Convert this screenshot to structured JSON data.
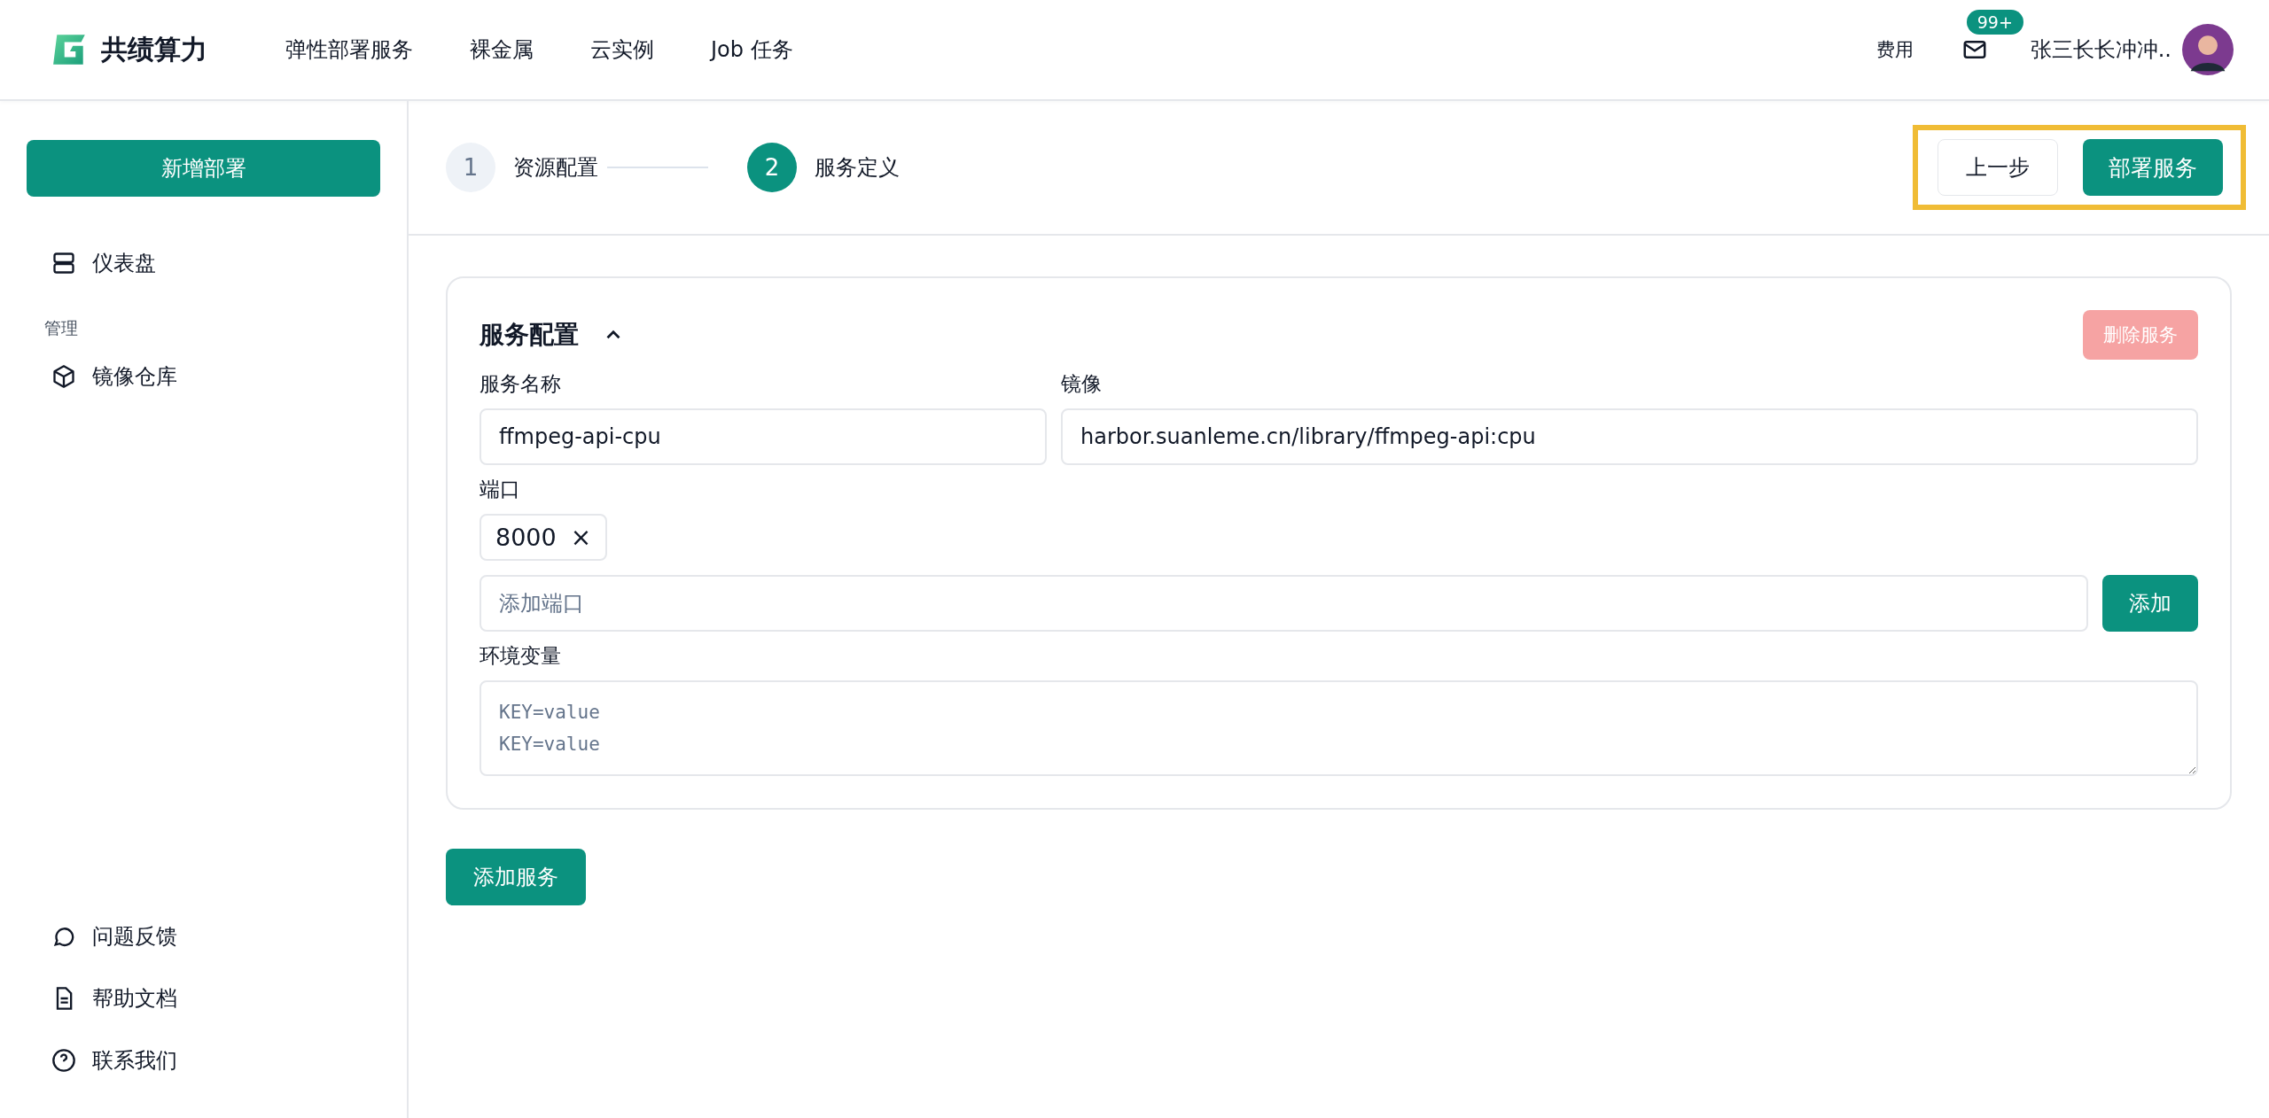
{
  "header": {
    "brand": "共绩算力",
    "nav": [
      {
        "label": "弹性部署服务",
        "selected": false
      },
      {
        "label": "裸金属",
        "selected": false
      },
      {
        "label": "云实例",
        "selected": false
      },
      {
        "label": "Job 任务",
        "selected": false
      }
    ],
    "billing": "费用",
    "mail_badge": "99+",
    "user_name": "张三长长冲冲.."
  },
  "sidebar": {
    "new_button": "新增部署",
    "items": [
      {
        "label": "仪表盘",
        "kind": "dashboard"
      }
    ],
    "section": "管理",
    "section_items": [
      {
        "label": "镜像仓库",
        "kind": "package"
      }
    ],
    "footer_items": [
      {
        "label": "问题反馈",
        "kind": "chat"
      },
      {
        "label": "帮助文档",
        "kind": "doc"
      },
      {
        "label": "联系我们",
        "kind": "help"
      }
    ]
  },
  "steps": [
    {
      "number": "1",
      "label": "资源配置",
      "selected": false
    },
    {
      "number": "2",
      "label": "服务定义",
      "selected": true
    }
  ],
  "actions": {
    "back": "上一步",
    "deploy": "部署服务"
  },
  "service": {
    "title": "服务配置",
    "expanded": true,
    "delete_button": "删除服务",
    "delete_disabled": true,
    "name_label": "服务名称",
    "name_value": "ffmpeg-api-cpu",
    "image_label": "镜像",
    "image_value": "harbor.suanleme.cn/library/ffmpeg-api:cpu",
    "port_label": "端口",
    "ports": [
      "8000"
    ],
    "remove_icon": "×",
    "port_placeholder": "添加端口",
    "add_port_button": "添加",
    "env_label": "环境变量",
    "env_placeholder": "KEY=value\nKEY=value"
  },
  "add_service_button": "添加服务"
}
